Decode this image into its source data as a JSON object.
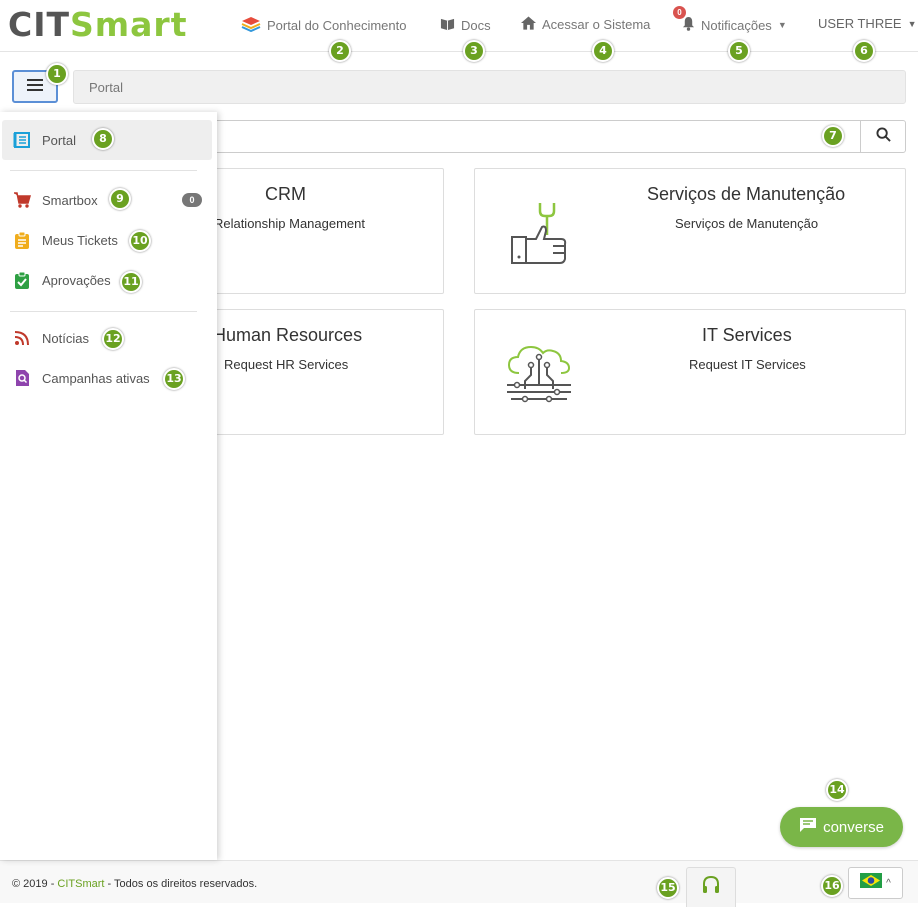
{
  "header": {
    "logo_part1": "CIT",
    "logo_part2": "Smart",
    "nav": {
      "knowledge_portal": "Portal do Conhecimento",
      "docs": "Docs",
      "access_system": "Acessar o Sistema",
      "notifications": "Notificações",
      "notifications_count": "0",
      "user": "USER THREE"
    }
  },
  "breadcrumb": {
    "current": "Portal"
  },
  "search": {
    "value": "",
    "placeholder": ""
  },
  "cards": [
    {
      "title": "CRM",
      "description": "Customer Relationship Management",
      "icon": "crm-icon"
    },
    {
      "title": "Serviços de Manutenção",
      "description": "Serviços de Manutenção",
      "icon": "thumbs-up-wrench-icon"
    },
    {
      "title": "Human Resources",
      "description": "Request HR Services",
      "icon": "people-icon"
    },
    {
      "title": "IT Services",
      "description": "Request IT Services",
      "icon": "cloud-circuit-icon"
    }
  ],
  "sidebar": {
    "items": [
      {
        "label": "Portal",
        "icon": "portal-icon",
        "color": "#1aa0d8"
      },
      {
        "label": "Smartbox",
        "icon": "cart-icon",
        "color": "#c0392b",
        "count": "0"
      },
      {
        "label": "Meus Tickets",
        "icon": "clipboard-icon",
        "color": "#f0ad1d"
      },
      {
        "label": "Aprovações",
        "icon": "clipboard-check-icon",
        "color": "#2ea043"
      },
      {
        "label": "Notícias",
        "icon": "rss-icon",
        "color": "#c0392b"
      },
      {
        "label": "Campanhas ativas",
        "icon": "campaign-search-icon",
        "color": "#8e44ad"
      }
    ]
  },
  "chat": {
    "label": "converse"
  },
  "footer": {
    "prefix": "© 2019 - ",
    "brand": "CITSmart",
    "suffix": " - Todos os direitos reservados."
  },
  "steps": [
    "1",
    "2",
    "3",
    "4",
    "5",
    "6",
    "7",
    "8",
    "9",
    "10",
    "11",
    "12",
    "13",
    "14",
    "15",
    "16"
  ],
  "colors": {
    "brand_green": "#8dc63f",
    "step_green": "#6aa121",
    "chat_green": "#7ab648",
    "notification_red": "#d9534f"
  }
}
